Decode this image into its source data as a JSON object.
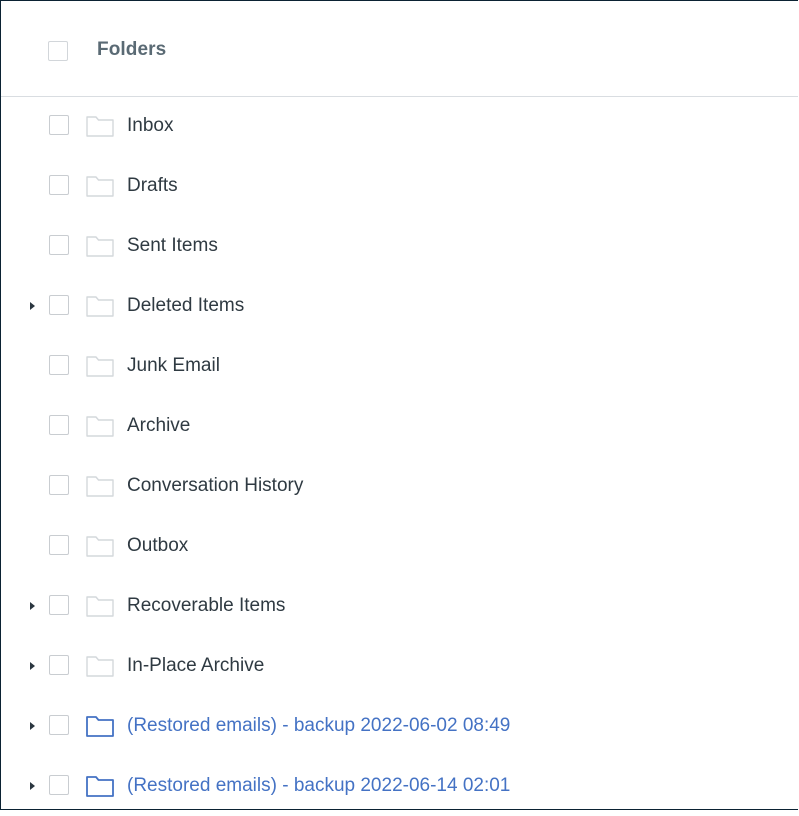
{
  "header": {
    "title": "Folders"
  },
  "colors": {
    "normal_text": "#2f3a42",
    "restored_text": "#4472c4",
    "folder_gray": "#d4d8dc",
    "folder_blue": "#4472c4"
  },
  "folders": [
    {
      "label": "Inbox",
      "expandable": false,
      "restored": false
    },
    {
      "label": "Drafts",
      "expandable": false,
      "restored": false
    },
    {
      "label": "Sent Items",
      "expandable": false,
      "restored": false
    },
    {
      "label": "Deleted Items",
      "expandable": true,
      "restored": false
    },
    {
      "label": "Junk Email",
      "expandable": false,
      "restored": false
    },
    {
      "label": "Archive",
      "expandable": false,
      "restored": false
    },
    {
      "label": "Conversation History",
      "expandable": false,
      "restored": false
    },
    {
      "label": "Outbox",
      "expandable": false,
      "restored": false
    },
    {
      "label": "Recoverable Items",
      "expandable": true,
      "restored": false
    },
    {
      "label": "In-Place Archive",
      "expandable": true,
      "restored": false
    },
    {
      "label": "(Restored emails) - backup 2022-06-02 08:49",
      "expandable": true,
      "restored": true
    },
    {
      "label": "(Restored emails) - backup 2022-06-14 02:01",
      "expandable": true,
      "restored": true
    }
  ]
}
